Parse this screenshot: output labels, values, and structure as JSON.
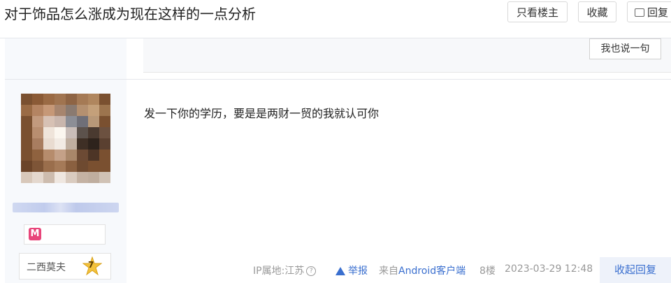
{
  "header": {
    "title": "对于饰品怎么涨成为现在这样的一点分析",
    "only_owner_label": "只看楼主",
    "collect_label": "收藏",
    "reply_label": "回复"
  },
  "subreply": {
    "say_label": "我也说一句"
  },
  "post": {
    "content": "发一下你的学历，要是是两财一贸的我就认可你",
    "badge_icon_char": "M",
    "level_name": "二西莫夫",
    "level_number": "7",
    "ip_label": "IP属地:江苏",
    "help_icon_char": "?",
    "report_label": "举报",
    "from_prefix": "来自",
    "client_label": "Android客户端",
    "floor": "8楼",
    "datetime": "2023-03-29 12:48",
    "collapse_label": "收起回复"
  },
  "colors": {
    "link_blue": "#3a6fcf",
    "sidebar_bg": "#f7f9fc",
    "badge_pink": "#e8457a",
    "level_star": "#f3c23c"
  },
  "icons": [
    "reply-icon",
    "badge-icon",
    "level-star-icon",
    "help-icon",
    "warning-icon"
  ]
}
